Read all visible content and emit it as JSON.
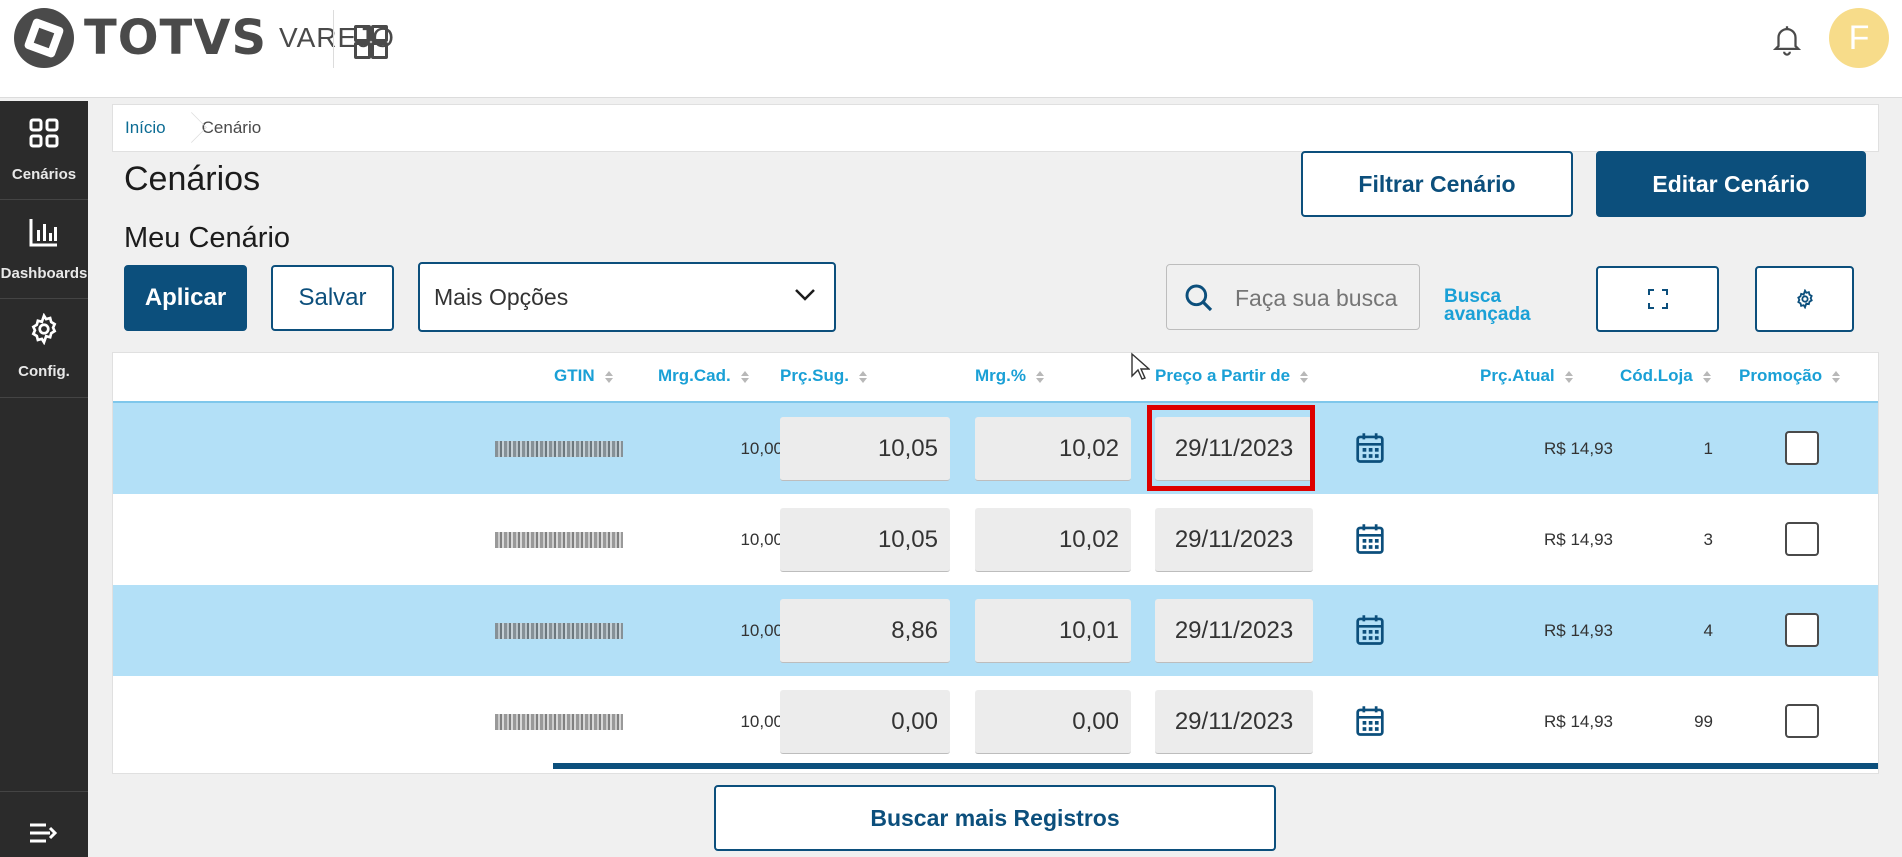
{
  "header": {
    "logo_text": "TOTVS",
    "logo_sub": "VAREJO",
    "avatar_initial": "F"
  },
  "sidebar": {
    "items": [
      {
        "label": "Cenários",
        "icon": "grid-icon"
      },
      {
        "label": "Dashboards",
        "icon": "bar-chart-icon"
      },
      {
        "label": "Config.",
        "icon": "gear-icon"
      }
    ]
  },
  "breadcrumb": {
    "home": "Início",
    "current": "Cenário"
  },
  "page": {
    "title": "Cenários",
    "subtitle": "Meu Cenário",
    "filter_button": "Filtrar Cenário",
    "edit_button": "Editar Cenário",
    "apply_button": "Aplicar",
    "save_button": "Salvar",
    "options_select": "Mais Opções",
    "search_placeholder": "Faça sua busca",
    "advanced_search_line1": "Busca",
    "advanced_search_line2": "avançada",
    "more_records_button": "Buscar mais Registros"
  },
  "table": {
    "columns": [
      "GTIN",
      "Mrg.Cad.",
      "Prç.Sug.",
      "Mrg.%",
      "Preço a Partir de",
      "Prç.Atual",
      "Cód.Loja",
      "Promoção"
    ],
    "rows": [
      {
        "mrg_cad": "10,00",
        "prc_sug": "10,05",
        "mrg_pct": "10,02",
        "date": "29/11/2023",
        "prc_atual": "R$ 14,93",
        "cod_loja": "1"
      },
      {
        "mrg_cad": "10,00",
        "prc_sug": "10,05",
        "mrg_pct": "10,02",
        "date": "29/11/2023",
        "prc_atual": "R$ 14,93",
        "cod_loja": "3"
      },
      {
        "mrg_cad": "10,00",
        "prc_sug": "8,86",
        "mrg_pct": "10,01",
        "date": "29/11/2023",
        "prc_atual": "R$ 14,93",
        "cod_loja": "4"
      },
      {
        "mrg_cad": "10,00",
        "prc_sug": "0,00",
        "mrg_pct": "0,00",
        "date": "29/11/2023",
        "prc_atual": "R$ 14,93",
        "cod_loja": "99"
      }
    ]
  },
  "colors": {
    "primary": "#0c4f7c",
    "accent": "#1aa0d6",
    "selected_row": "#b3e0f7",
    "highlight": "#dd0000"
  }
}
